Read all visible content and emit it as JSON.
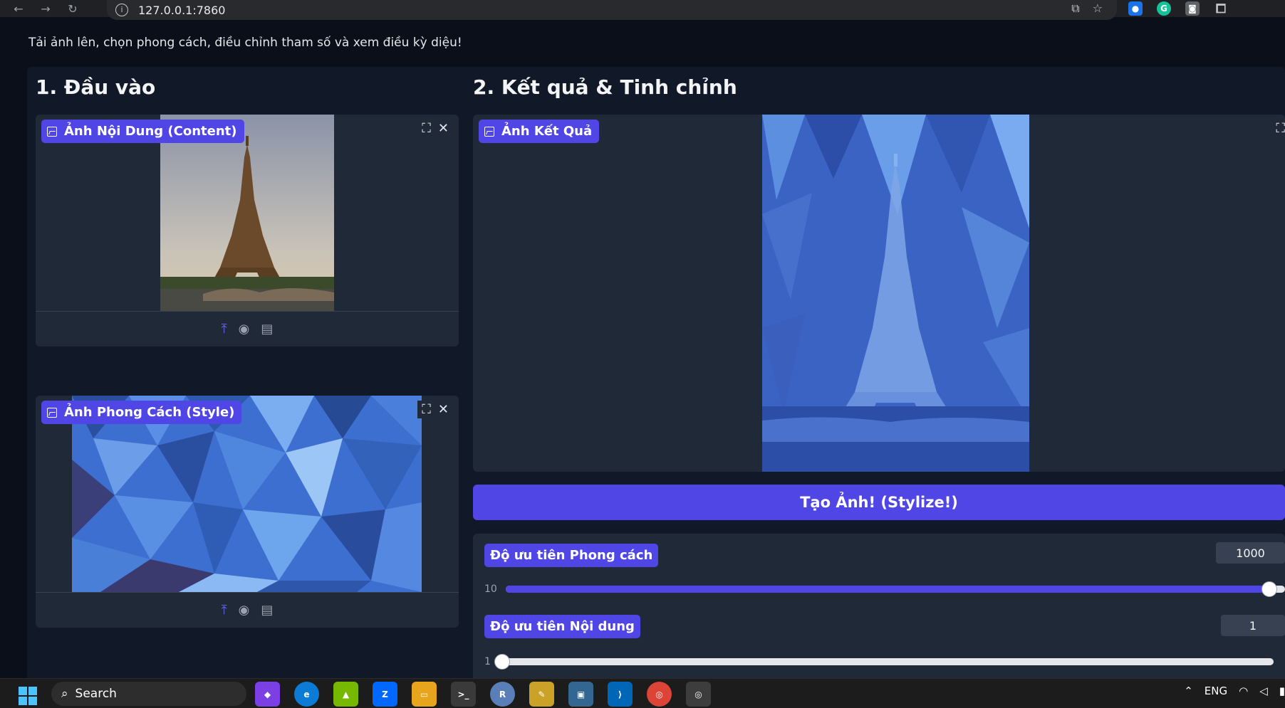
{
  "browser": {
    "url": "127.0.0.1:7860",
    "nav_icons": [
      "back-arrow-icon",
      "forward-arrow-icon",
      "reload-icon"
    ],
    "extensions": [
      "translate-icon",
      "bookmark-star-icon",
      "droplet-extension-icon",
      "grammarly-icon",
      "camera-extension-icon",
      "puzzle-extensions-icon"
    ]
  },
  "page": {
    "subtitle": "Tải ảnh lên, chọn phong cách, điều chỉnh tham số và xem điều kỳ diệu!",
    "input_heading": "1. Đầu vào",
    "output_heading": "2. Kết quả & Tinh chỉnh",
    "content_image_label": "Ảnh Nội Dung (Content)",
    "style_image_label": "Ảnh Phong Cách (Style)",
    "result_image_label": "Ảnh Kết Quả",
    "run_button": "Tạo Ảnh! (Stylize!)",
    "style_weight": {
      "label": "Độ ưu tiên Phong cách",
      "value": "1000",
      "min": "10",
      "fraction": 0.98
    },
    "content_weight": {
      "label": "Độ ưu tiên Nội dung",
      "value": "1",
      "min": "1",
      "fraction": 0.0
    },
    "accent_color": "#4f46e5"
  },
  "taskbar": {
    "search_placeholder": "Search",
    "language": "ENG"
  }
}
